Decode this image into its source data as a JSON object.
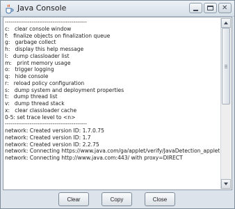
{
  "window": {
    "title": "Java Console"
  },
  "console_lines": [
    "-------------------------------------------",
    "c:   clear console window",
    "f:   finalize objects on finalization queue",
    "g:   garbage collect",
    "h:   display this help message",
    "l:   dump classloader list",
    "m:   print memory usage",
    "o:   trigger logging",
    "q:   hide console",
    "r:   reload policy configuration",
    "s:   dump system and deployment properties",
    "t:   dump thread list",
    "v:   dump thread stack",
    "x:   clear classloader cache",
    "0-5: set trace level to <n>",
    "-------------------------------------------",
    "network: Created version ID: 1.7.0.75",
    "network: Created version ID: 1.7",
    "network: Created version ID: 2.2.75",
    "network: Connecting https://www.java.com/ga/applet/verify/JavaDetection_applet.j",
    "network: Connecting http://www.java.com:443/ with proxy=DIRECT",
    "",
    "",
    "",
    ""
  ],
  "buttons": {
    "clear": "Clear",
    "copy": "Copy",
    "close": "Close"
  },
  "icons": {
    "app": "java-cup-icon",
    "minimize": "minimize-icon",
    "maximize": "maximize-icon",
    "close": "close-icon"
  }
}
